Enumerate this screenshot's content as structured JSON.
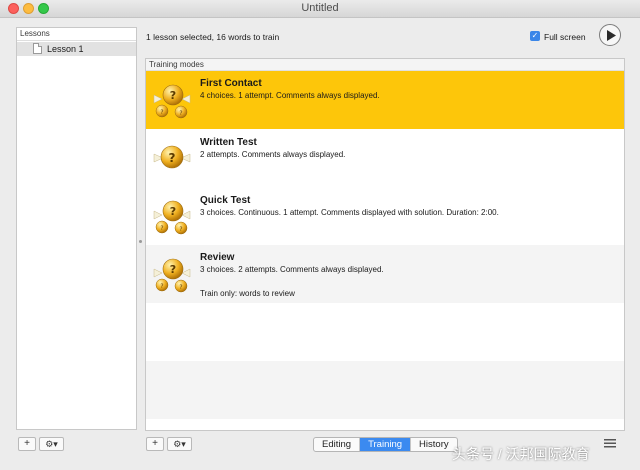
{
  "window": {
    "title": "Untitled"
  },
  "lessons": {
    "header": "Lessons",
    "items": [
      {
        "label": "Lesson 1"
      }
    ]
  },
  "status": {
    "text": "1 lesson selected, 16 words to train"
  },
  "fullscreen": {
    "label": "Full screen",
    "checked": true
  },
  "training": {
    "header": "Training modes",
    "modes": [
      {
        "name": "First Contact",
        "desc": "4 choices. 1 attempt. Comments always displayed.",
        "note": ""
      },
      {
        "name": "Written Test",
        "desc": "2 attempts. Comments always displayed.",
        "note": ""
      },
      {
        "name": "Quick Test",
        "desc": "3 choices. Continuous. 1 attempt. Comments displayed with solution. Duration: 2:00.",
        "note": ""
      },
      {
        "name": "Review",
        "desc": "3 choices. 2 attempts. Comments always displayed.",
        "note": "Train only: words to review"
      }
    ]
  },
  "bottom": {
    "add_label": "+",
    "gear_label": "⚙▾",
    "tabs": [
      {
        "label": "Editing",
        "active": false
      },
      {
        "label": "Training",
        "active": true
      },
      {
        "label": "History",
        "active": false
      }
    ]
  },
  "watermark": "头条号 / 沃邦国际教育",
  "colors": {
    "selected_row": "#fdc60a",
    "accent": "#3b8af0"
  }
}
